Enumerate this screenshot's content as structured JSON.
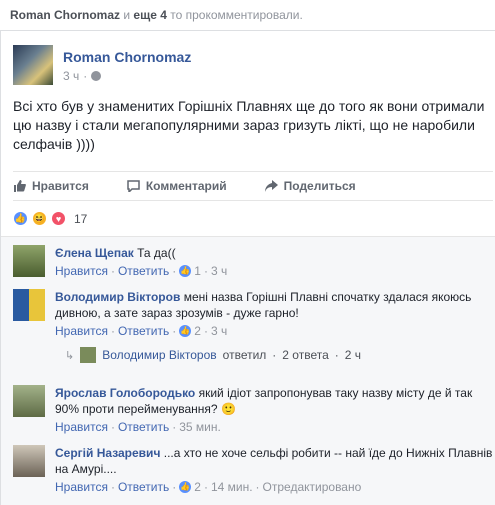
{
  "topline": {
    "name": "Roman Chornomaz",
    "conj": "и",
    "others": "еще 4",
    "rest": "то прокомментировали."
  },
  "post": {
    "author": "Roman Chornomaz",
    "time": "3 ч",
    "text": "Всі хто був у знаменитих Горішніх Плавнях ще до того як вони отримали цю назву і стали мегапопулярними зараз гризуть лікті, що не наробили селфачів ))))"
  },
  "actions": {
    "like": "Нравится",
    "comment": "Комментарий",
    "share": "Поделиться"
  },
  "reactions": {
    "count": "17"
  },
  "comments": [
    {
      "name": "Єлена Щепак",
      "text": "Та да((",
      "links": [
        "Нравится",
        "Ответить"
      ],
      "likes": "1",
      "time": "3 ч"
    },
    {
      "name": "Володимир Вікторов",
      "text": "мені назва Горішні Плавні спочатку здалася якоюсь дивною, а зате зараз зрозумів - дуже гарно!",
      "links": [
        "Нравится",
        "Ответить"
      ],
      "likes": "2",
      "time": "3 ч",
      "reply": {
        "name": "Володимир Вікторов",
        "label": "ответил",
        "count": "2 ответа",
        "time": "2 ч"
      }
    },
    {
      "name": "Ярослав Голобородько",
      "text": "який ідіот запропонував таку назву місту де й так 90% проти перейменування?",
      "emoji": "🙂",
      "links": [
        "Нравится",
        "Ответить"
      ],
      "time": "35 мин."
    },
    {
      "name": "Сергій Назаревич",
      "text": "...а хто не хоче сельфі робити -- най їде до Нижніх Плавнів на Амурі....",
      "links": [
        "Нравится",
        "Ответить"
      ],
      "likes": "2",
      "time": "14 мин.",
      "edited": "Отредактировано"
    }
  ],
  "colors": {
    "link": "#365899",
    "meta": "#90949c",
    "like": "#5890ff"
  }
}
